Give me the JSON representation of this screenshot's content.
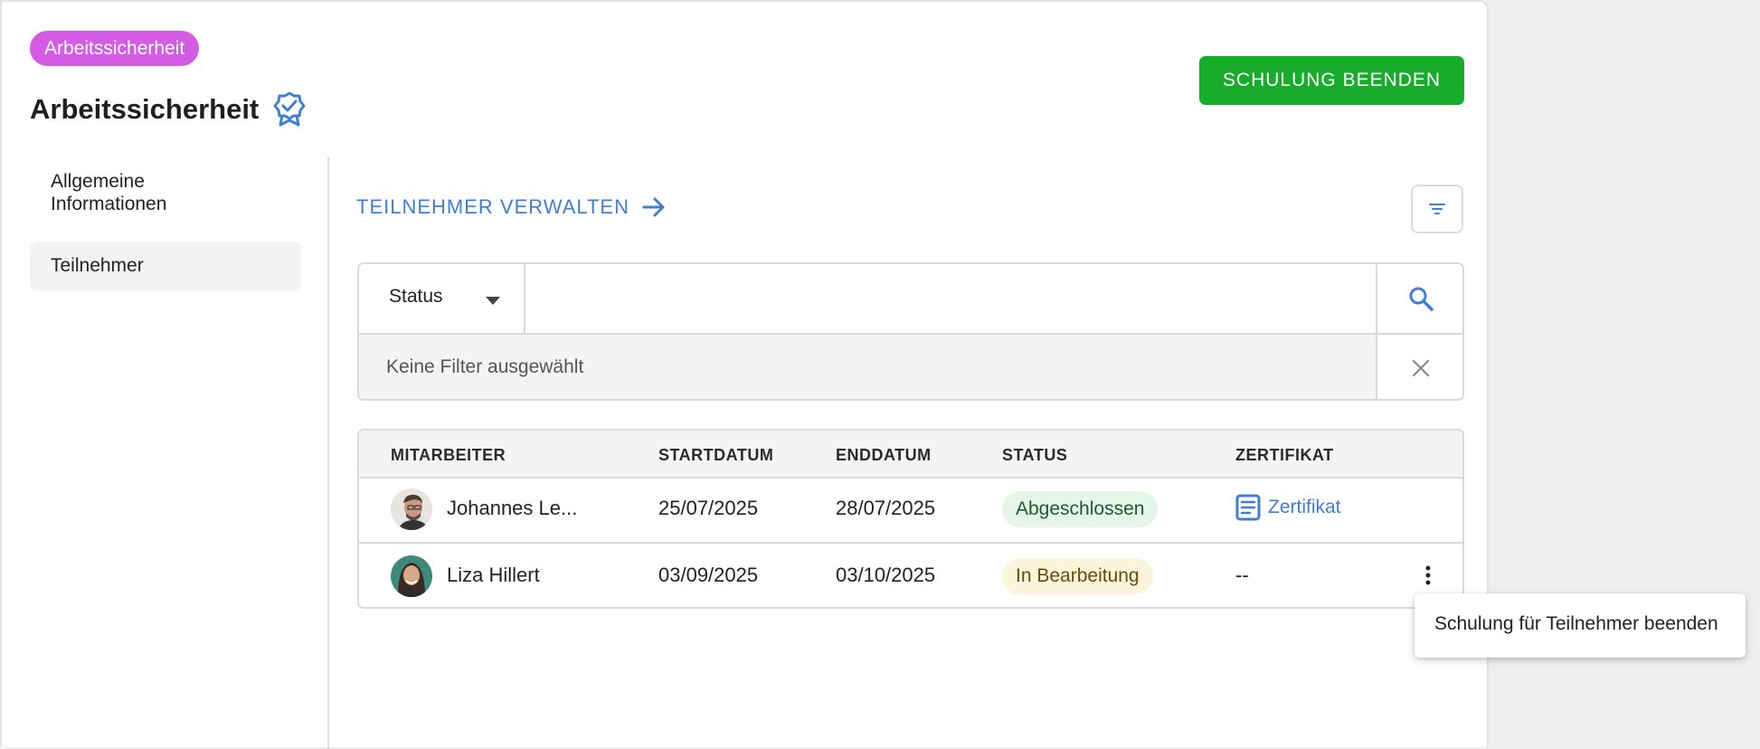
{
  "header": {
    "category_badge": "Arbeitssicherheit",
    "title": "Arbeitssicherheit",
    "end_training_label": "SCHULUNG BEENDEN",
    "badge_color": "#d45be3",
    "primary_color": "#17ad2a"
  },
  "sidebar": {
    "items": [
      {
        "label": "Allgemeine Informationen",
        "active": false
      },
      {
        "label": "Teilnehmer",
        "active": true
      }
    ]
  },
  "main": {
    "manage_link": "TEILNEHMER VERWALTEN",
    "filter_icon": "filter-lines-icon",
    "filter": {
      "status_label": "Status",
      "search_value": "",
      "no_filter_text": "Keine Filter ausgewählt"
    },
    "table": {
      "columns": [
        "MITARBEITER",
        "STARTDATUM",
        "ENDDATUM",
        "STATUS",
        "ZERTIFIKAT"
      ],
      "rows": [
        {
          "employee": "Johannes Le...",
          "start": "25/07/2025",
          "end": "28/07/2025",
          "status": "Abgeschlossen",
          "certificate": "Zertifikat"
        },
        {
          "employee": "Liza Hillert",
          "start": "03/09/2025",
          "end": "03/10/2025",
          "status": "In Bearbeitung",
          "certificate": "--"
        }
      ]
    },
    "context_menu": {
      "item": "Schulung für Teilnehmer beenden"
    }
  },
  "colors": {
    "link": "#3f7fd6",
    "status_done_bg": "#e5f6e8",
    "status_progress_bg": "#fdf4dc"
  }
}
